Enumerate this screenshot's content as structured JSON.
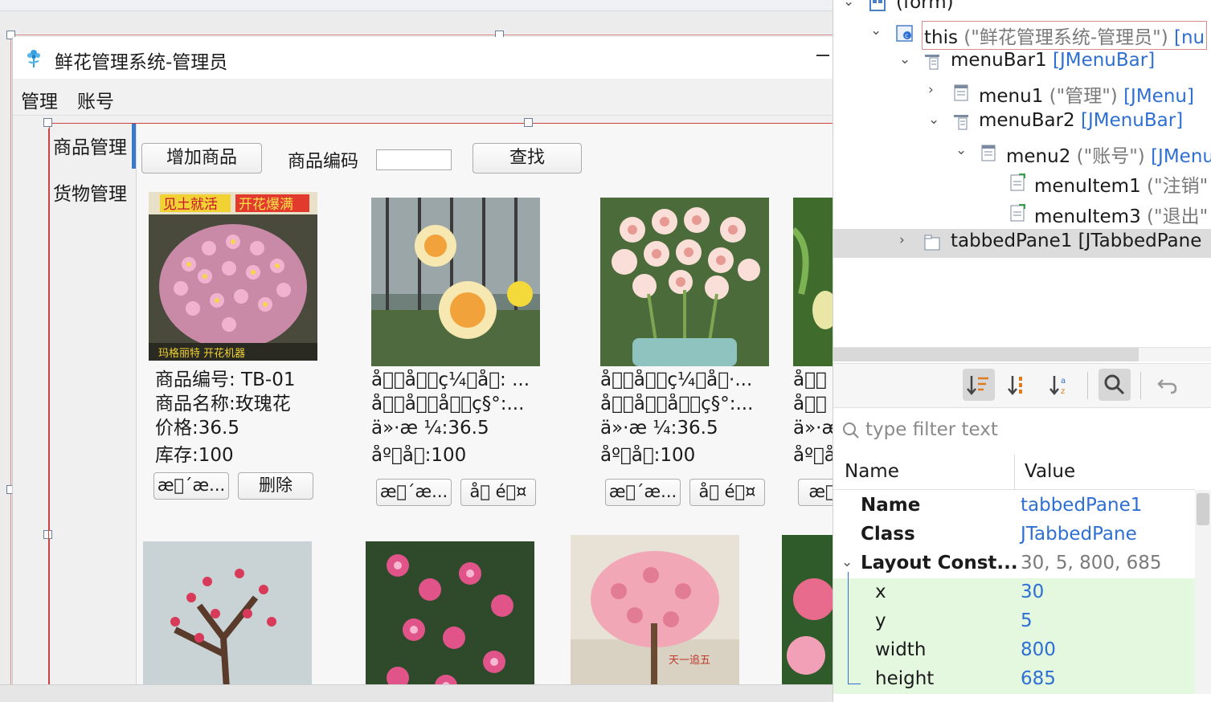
{
  "designer": {
    "window_title": "鲜花管理系统-管理员",
    "menus": [
      "管理",
      "账号"
    ],
    "tabs": [
      "商品管理",
      "货物管理"
    ],
    "toolbar": {
      "add_button": "增加商品",
      "code_label": "商品编码",
      "code_value": "",
      "search_button": "查找"
    },
    "products": [
      {
        "badge_left": "见土就活",
        "badge_right": "开花爆满",
        "caption_bottom": "玛格丽特 开花机器",
        "lines": [
          "商品编号: TB-01",
          "商品名称:玫瑰花",
          "价格:36.5",
          "库存:100"
        ],
        "buttons": [
          "æ\u0000´æ...",
          "删除"
        ]
      },
      {
        "lines": [
          "å\u0000\u0000å\u0000\u0000ç¼\u0000å\u0000: ...",
          "å\u0000\u0000å\u0000\u0000å\u0000\u0000ç§°:...",
          "ä»·æ ¼:36.5",
          "åº\u0000å­\u0000:100"
        ],
        "buttons": [
          "æ\u0000´æ...",
          "å\u0000 é\u0000¤"
        ]
      },
      {
        "lines": [
          "å\u0000\u0000å\u0000\u0000ç¼\u0000å\u0000·...",
          "å\u0000\u0000å\u0000\u0000å\u0000\u0000ç§°:...",
          "ä»·æ ¼:36.5",
          "åº\u0000å­\u0000:100"
        ],
        "buttons": [
          "æ\u0000´æ...",
          "å\u0000 é\u0000¤"
        ]
      },
      {
        "lines": [
          "å\u0000\u0000",
          "å\u0000\u0000",
          "ä»·æ",
          "åº\u0000å"
        ],
        "buttons": [
          "æ\u0000"
        ]
      }
    ],
    "watermark": "天一追五"
  },
  "component_tree": {
    "rows": [
      {
        "name": "(form)",
        "meta": "",
        "type": "",
        "expanded": true
      },
      {
        "name": "this",
        "meta": " (\"鲜花管理系统-管理员\")",
        "type": " [nu",
        "expanded": true
      },
      {
        "name": "menuBar1",
        "meta": "",
        "type": " [JMenuBar]",
        "expanded": true
      },
      {
        "name": "menu1",
        "meta": " (\"管理\")",
        "type": " [JMenu]",
        "expanded": false
      },
      {
        "name": "menuBar2",
        "meta": "",
        "type": " [JMenuBar]",
        "expanded": true
      },
      {
        "name": "menu2",
        "meta": " (\"账号\")",
        "type": " [JMenu",
        "expanded": true
      },
      {
        "name": "menuItem1",
        "meta": " (\"注销\"",
        "type": "",
        "expanded": false
      },
      {
        "name": "menuItem3",
        "meta": " (\"退出\"",
        "type": "",
        "expanded": false
      },
      {
        "name": "tabbedPane1",
        "meta": "",
        "type": " [JTabbedPane",
        "expanded": false
      }
    ]
  },
  "properties": {
    "filter_placeholder": "type filter text",
    "header": {
      "name": "Name",
      "value": "Value"
    },
    "rows": [
      {
        "name": "Name",
        "value": "tabbedPane1"
      },
      {
        "name": "Class",
        "value": "JTabbedPane"
      },
      {
        "name": "Layout Const...",
        "value": "30, 5, 800, 685"
      },
      {
        "name": "x",
        "value": "30"
      },
      {
        "name": "y",
        "value": "5"
      },
      {
        "name": "width",
        "value": "800"
      },
      {
        "name": "height",
        "value": "685"
      }
    ]
  },
  "colors": {
    "selection_red": "#d04040",
    "accent_blue": "#2e6fd3",
    "tab_indicator": "#3a78c9",
    "property_highlight": "#e4f7df"
  },
  "icons": [
    "app-flower-icon",
    "component-icon",
    "menubar-icon",
    "menu-icon",
    "menuitem-icon",
    "tabbedpane-icon",
    "sort-icon",
    "search-icon",
    "undo-icon",
    "chevron-icon"
  ]
}
